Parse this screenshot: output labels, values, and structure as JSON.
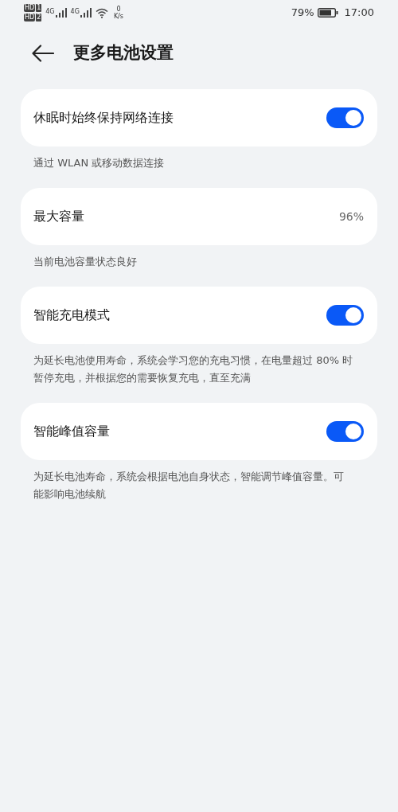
{
  "status_bar": {
    "sim_1": "1",
    "sim_2": "2",
    "hd_1": "HD",
    "hd_2": "HD",
    "network_1": "4G",
    "network_2": "4G",
    "speed_value": "0",
    "speed_unit": "K/s",
    "battery": "79%",
    "time": "17:00"
  },
  "header": {
    "title": "更多电池设置"
  },
  "settings": [
    {
      "kind": "toggle",
      "label": "休眠时始终保持网络连接",
      "on": true,
      "caption": "通过 WLAN 或移动数据连接"
    },
    {
      "kind": "value",
      "label": "最大容量",
      "value": "96%",
      "caption": "当前电池容量状态良好"
    },
    {
      "kind": "toggle",
      "label": "智能充电模式",
      "on": true,
      "caption": "为延长电池使用寿命，系统会学习您的充电习惯，在电量超过 80% 时暂停充电，并根据您的需要恢复充电，直至充满"
    },
    {
      "kind": "toggle",
      "label": "智能峰值容量",
      "on": true,
      "caption": "为延长电池寿命，系统会根据电池自身状态，智能调节峰值容量。可能影响电池续航"
    }
  ]
}
